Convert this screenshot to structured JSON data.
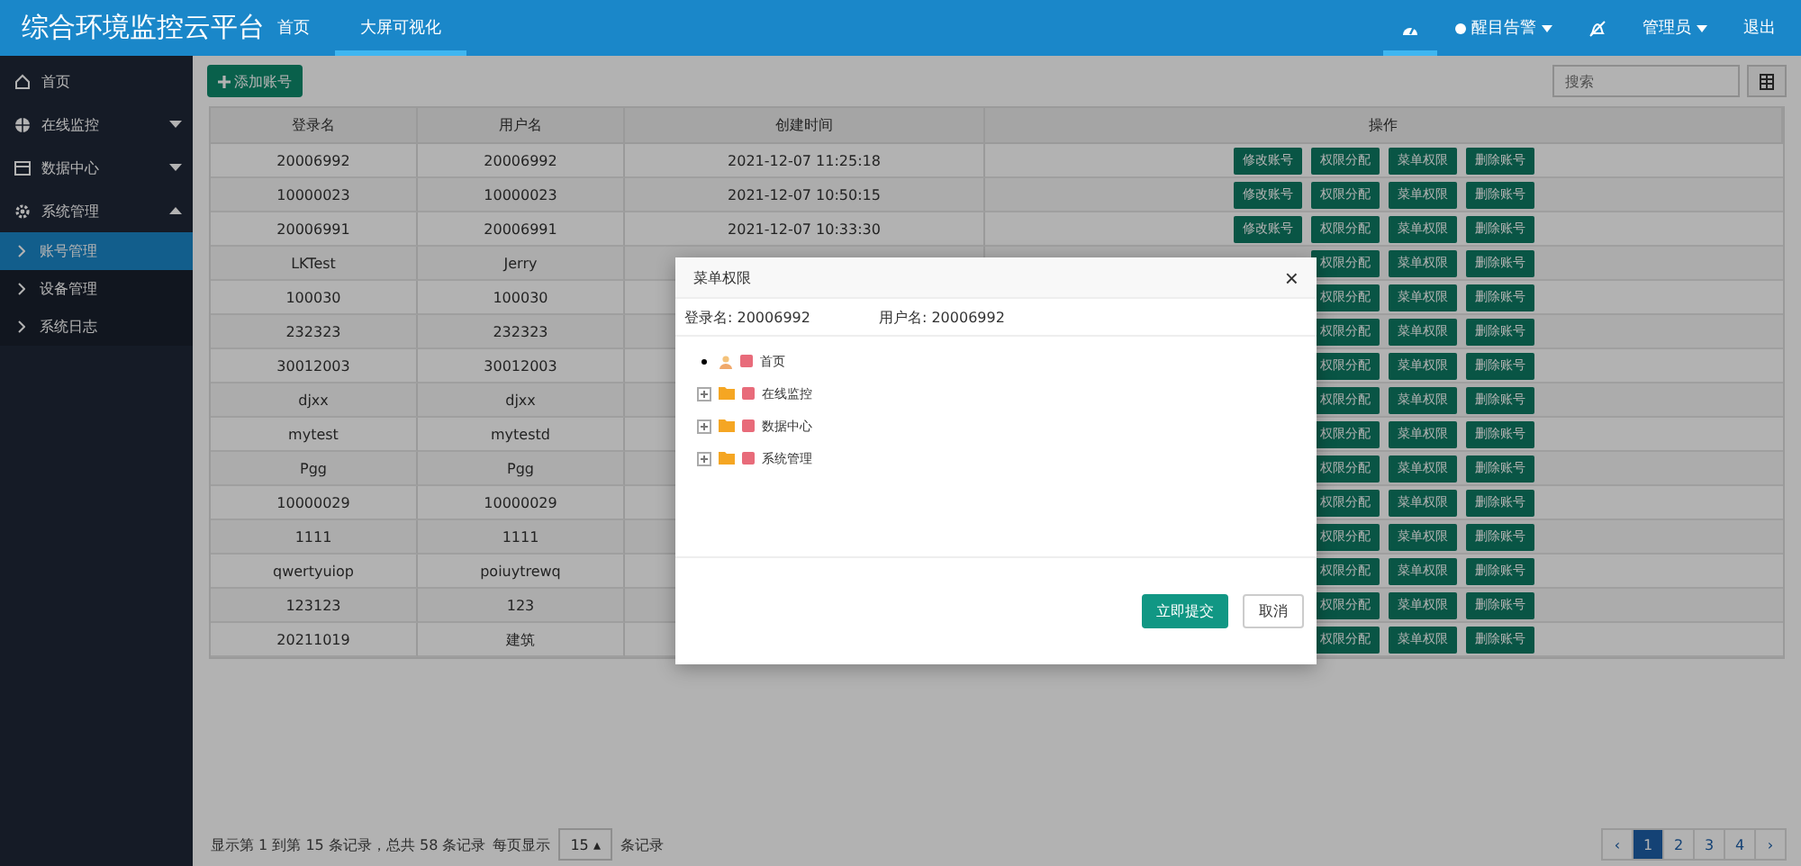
{
  "header": {
    "title": "综合环境监控云平台",
    "nav": [
      {
        "label": "首页",
        "selected": false
      },
      {
        "label": "大屏可视化",
        "selected": true
      }
    ],
    "alarm": "醒目告警",
    "user": "管理员",
    "logout": "退出"
  },
  "sidebar": [
    {
      "label": "首页"
    },
    {
      "label": "在线监控",
      "expanded": false
    },
    {
      "label": "数据中心",
      "expanded": false
    },
    {
      "label": "系统管理",
      "expanded": true,
      "children": [
        {
          "label": "账号管理",
          "selected": true
        },
        {
          "label": "设备管理",
          "selected": false
        },
        {
          "label": "系统日志",
          "selected": false
        }
      ]
    }
  ],
  "toolbar": {
    "add_button": "添加账号",
    "search_placeholder": "搜索"
  },
  "table": {
    "columns": [
      "登录名",
      "用户名",
      "创建时间",
      "操作"
    ],
    "rows": [
      {
        "login": "20006992",
        "user": "20006992",
        "created": "2021-12-07 11:25:18",
        "actions": [
          "修改账号",
          "权限分配",
          "菜单权限",
          "删除账号"
        ]
      },
      {
        "login": "10000023",
        "user": "10000023",
        "created": "2021-12-07 10:50:15",
        "actions": [
          "修改账号",
          "权限分配",
          "菜单权限",
          "删除账号"
        ]
      },
      {
        "login": "20006991",
        "user": "20006991",
        "created": "2021-12-07 10:33:30",
        "actions": [
          "修改账号",
          "权限分配",
          "菜单权限",
          "删除账号"
        ]
      },
      {
        "login": "LKTest",
        "user": "Jerry",
        "actions": [
          "权限分配",
          "菜单权限",
          "删除账号"
        ]
      },
      {
        "login": "100030",
        "user": "100030",
        "actions": [
          "权限分配",
          "菜单权限",
          "删除账号"
        ]
      },
      {
        "login": "232323",
        "user": "232323",
        "actions": [
          "权限分配",
          "菜单权限",
          "删除账号"
        ]
      },
      {
        "login": "30012003",
        "user": "30012003",
        "actions": [
          "权限分配",
          "菜单权限",
          "删除账号"
        ]
      },
      {
        "login": "djxx",
        "user": "djxx",
        "actions": [
          "权限分配",
          "菜单权限",
          "删除账号"
        ]
      },
      {
        "login": "mytest",
        "user": "mytestd",
        "actions": [
          "权限分配",
          "菜单权限",
          "删除账号"
        ]
      },
      {
        "login": "Pgg",
        "user": "Pgg",
        "actions": [
          "权限分配",
          "菜单权限",
          "删除账号"
        ]
      },
      {
        "login": "10000029",
        "user": "10000029",
        "actions": [
          "权限分配",
          "菜单权限",
          "删除账号"
        ]
      },
      {
        "login": "1111",
        "user": "1111",
        "actions": [
          "权限分配",
          "菜单权限",
          "删除账号"
        ]
      },
      {
        "login": "qwertyuiop",
        "user": "poiuytrewq",
        "actions": [
          "权限分配",
          "菜单权限",
          "删除账号"
        ]
      },
      {
        "login": "123123",
        "user": "123",
        "actions": [
          "权限分配",
          "菜单权限",
          "删除账号"
        ]
      },
      {
        "login": "20211019",
        "user": "建筑",
        "actions": [
          "权限分配",
          "菜单权限",
          "删除账号"
        ]
      }
    ]
  },
  "footer": {
    "summary": "显示第 1 到第 15 条记录，总共 58 条记录",
    "per_page_label": "每页显示",
    "per_page": "15 ▴",
    "per_page_suffix": "条记录",
    "pages": [
      {
        "label": "‹",
        "selected": false
      },
      {
        "label": "1",
        "selected": true
      },
      {
        "label": "2",
        "selected": false
      },
      {
        "label": "3",
        "selected": false
      },
      {
        "label": "4",
        "selected": false
      },
      {
        "label": "›",
        "selected": false
      }
    ]
  },
  "dialog": {
    "title": "菜单权限",
    "close": "×",
    "login_label": "登录名:",
    "login": "20006992",
    "user_label": "用户名:",
    "user": "20006992",
    "tree": [
      {
        "kind": "leaf",
        "label": "首页",
        "checked": true
      },
      {
        "kind": "folder",
        "label": "在线监控",
        "checked": true,
        "expanded": false
      },
      {
        "kind": "folder",
        "label": "数据中心",
        "checked": true,
        "expanded": false
      },
      {
        "kind": "folder",
        "label": "系统管理",
        "checked": true,
        "expanded": false
      }
    ],
    "submit": "立即提交",
    "cancel": "取消"
  }
}
